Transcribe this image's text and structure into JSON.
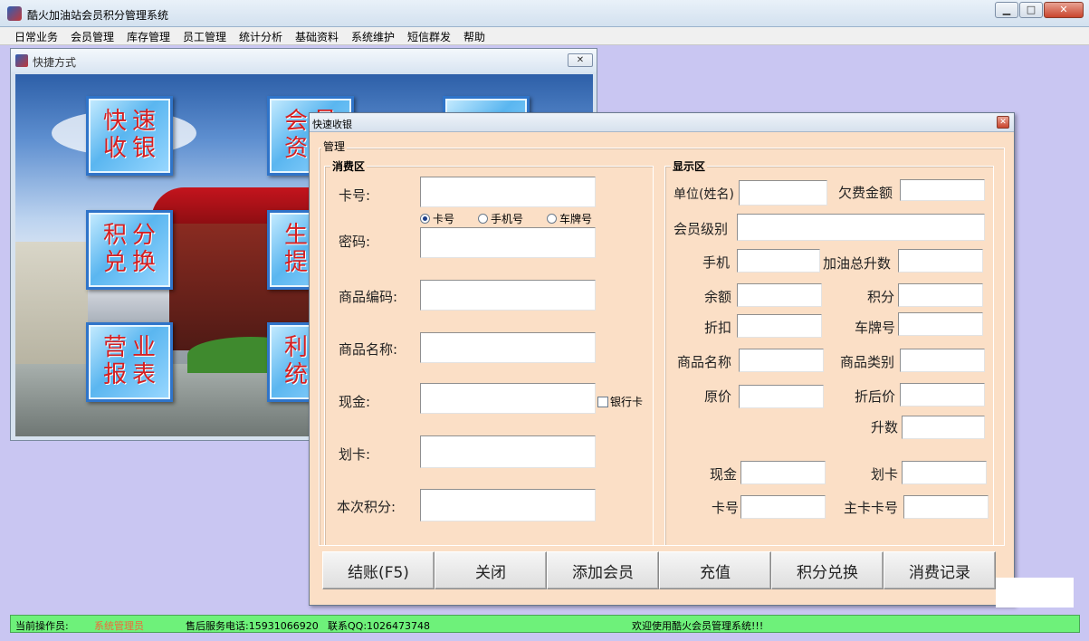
{
  "window": {
    "title": "酷火加油站会员积分管理系统",
    "btn_min": "▁",
    "btn_max": "□",
    "btn_close": "✕"
  },
  "menu": [
    "日常业务",
    "会员管理",
    "库存管理",
    "员工管理",
    "统计分析",
    "基础资料",
    "系统维护",
    "短信群发",
    "帮助"
  ],
  "shortcut": {
    "title": "快捷方式",
    "close": "✕",
    "tiles": [
      "快速收银",
      "会员资料",
      "积分兑换",
      "生成提醒",
      "营业报表",
      "利润统计"
    ]
  },
  "dialog": {
    "title": "快速收银",
    "close": "✕",
    "manage_label": "管理",
    "consume": {
      "heading": "消费区",
      "card_no": "卡号:",
      "radios": [
        "卡号",
        "手机号",
        "车牌号"
      ],
      "password": "密码:",
      "product_code": "商品编码:",
      "product_name": "商品名称:",
      "cash": "现金:",
      "bank_card": "银行卡",
      "swipe": "划卡:",
      "points": "本次积分:"
    },
    "display": {
      "heading": "显示区",
      "unit_name": "单位(姓名)",
      "arrears": "欠费金额",
      "member_level": "会员级别",
      "phone": "手机",
      "total_liters": "加油总升数",
      "balance": "余额",
      "points": "积分",
      "discount": "折扣",
      "plate": "车牌号",
      "product_name": "商品名称",
      "product_type": "商品类别",
      "orig_price": "原价",
      "disc_price": "折后价",
      "liters": "升数",
      "cash": "现金",
      "swipe": "划卡",
      "card_no": "卡号",
      "main_card_no": "主卡卡号"
    },
    "buttons": [
      "结账(F5)",
      "关闭",
      "添加会员",
      "充值",
      "积分兑换",
      "消费记录"
    ]
  },
  "status": {
    "operator_label": "当前操作员:",
    "operator": "系统管理员",
    "support": "售后服务电话:15931066920",
    "qq": "联系QQ:1026473748",
    "welcome": "欢迎使用酷火会员管理系统!!!"
  }
}
